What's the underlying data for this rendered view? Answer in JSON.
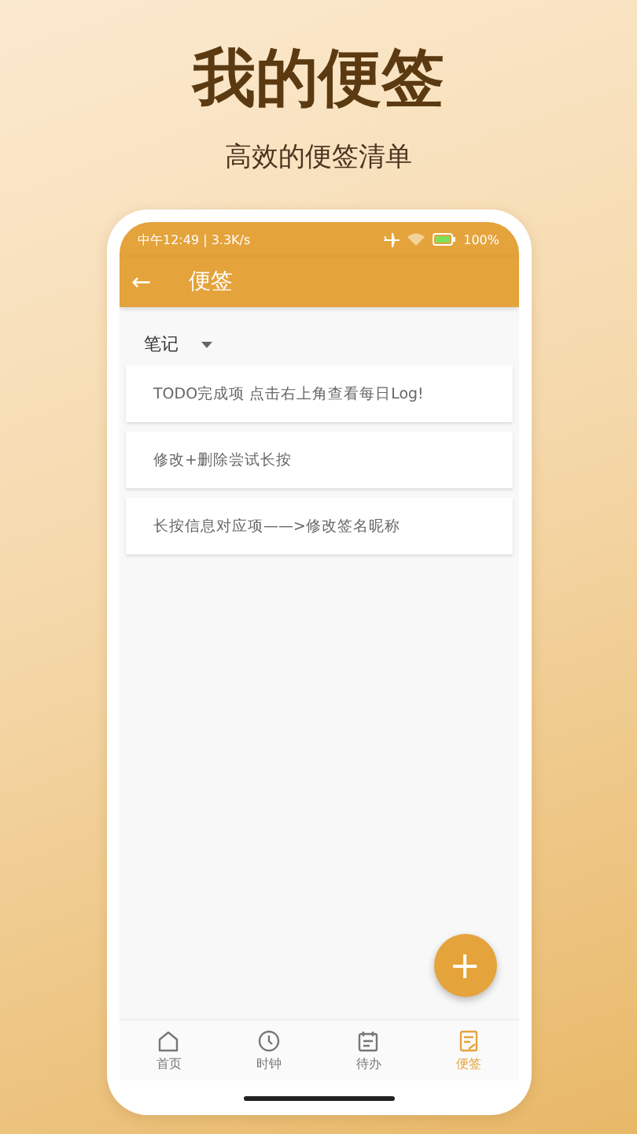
{
  "headline": {
    "title": "我的便签",
    "subtitle": "高效的便签清单"
  },
  "status_bar": {
    "time": "中午12:49 | 3.3K/s",
    "battery": "100%"
  },
  "app_bar": {
    "back": "←",
    "title": "便签"
  },
  "category": {
    "value": "笔记"
  },
  "notes": [
    {
      "text": "TODO完成项 点击右上角查看每日Log!"
    },
    {
      "text": "修改+删除尝试长按"
    },
    {
      "text": "长按信息对应项——>修改签名昵称"
    }
  ],
  "fab": {
    "label": "+"
  },
  "nav": [
    {
      "label": "首页",
      "kind": "home",
      "selected": false
    },
    {
      "label": "时钟",
      "kind": "clock",
      "selected": false
    },
    {
      "label": "待办",
      "kind": "calendar",
      "selected": false
    },
    {
      "label": "便签",
      "kind": "note",
      "selected": true
    }
  ]
}
